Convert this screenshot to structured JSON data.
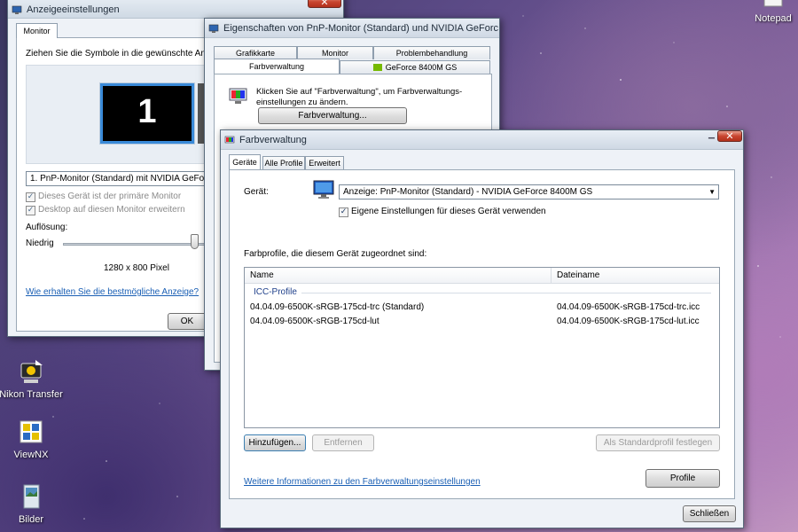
{
  "desktop": {
    "icons": [
      {
        "label": "Notepad",
        "icon": "notepad-icon"
      },
      {
        "label": "Nikon Transfer",
        "icon": "nikon-transfer-icon"
      },
      {
        "label": "ViewNX",
        "icon": "viewnx-icon"
      },
      {
        "label": "Bilder",
        "icon": "pictures-folder-icon"
      }
    ]
  },
  "display_settings": {
    "title": "Anzeigeeinstellungen",
    "tab": "Monitor",
    "instruction": "Ziehen Sie die Symbole in die gewünschte Anor",
    "monitor_number": "1",
    "monitor_select": "1. PnP-Monitor (Standard) mit NVIDIA GeForce",
    "primary_checkbox": "Dieses Gerät ist der primäre Monitor",
    "extend_checkbox": "Desktop auf diesen Monitor erweitern",
    "resolution_label": "Auflösung:",
    "low_label": "Niedrig",
    "resolution_value": "1280 x 800 Pixel",
    "help_link": "Wie erhalten Sie die bestmögliche Anzeige?",
    "ok_button": "OK"
  },
  "properties": {
    "title": "Eigenschaften von PnP-Monitor (Standard) und NVIDIA GeForc...",
    "tabs_row1": [
      "Grafikkarte",
      "Monitor",
      "Problembehandlung"
    ],
    "tabs_row2": [
      "Farbverwaltung",
      "GeForce 8400M GS"
    ],
    "active_tab": "Farbverwaltung",
    "description_line1": "Klicken Sie auf \"Farbverwaltung\", um Farbverwaltungs-",
    "description_line2": "einstellungen zu ändern.",
    "color_button": "Farbverwaltung..."
  },
  "color_management": {
    "title": "Farbverwaltung",
    "tabs": [
      "Geräte",
      "Alle Profile",
      "Erweitert"
    ],
    "active_tab": "Geräte",
    "device_label": "Gerät:",
    "device_value": "Anzeige: PnP-Monitor (Standard) - NVIDIA GeForce 8400M GS",
    "own_settings_checkbox": "Eigene Einstellungen für dieses Gerät verwenden",
    "own_settings_checked": true,
    "profiles_label": "Farbprofile, die diesem Gerät zugeordnet sind:",
    "columns": [
      "Name",
      "Dateiname"
    ],
    "group": "ICC-Profile",
    "rows": [
      {
        "name": "04.04.09-6500K-sRGB-175cd-trc (Standard)",
        "file": "04.04.09-6500K-sRGB-175cd-trc.icc"
      },
      {
        "name": "04.04.09-6500K-sRGB-175cd-lut",
        "file": "04.04.09-6500K-sRGB-175cd-lut.icc"
      }
    ],
    "add_button": "Hinzufügen...",
    "remove_button": "Entfernen",
    "default_button": "Als Standardprofil festlegen",
    "more_info_link": "Weitere Informationen zu den Farbverwaltungseinstellungen",
    "profile_button": "Profile",
    "close_button": "Schließen"
  }
}
